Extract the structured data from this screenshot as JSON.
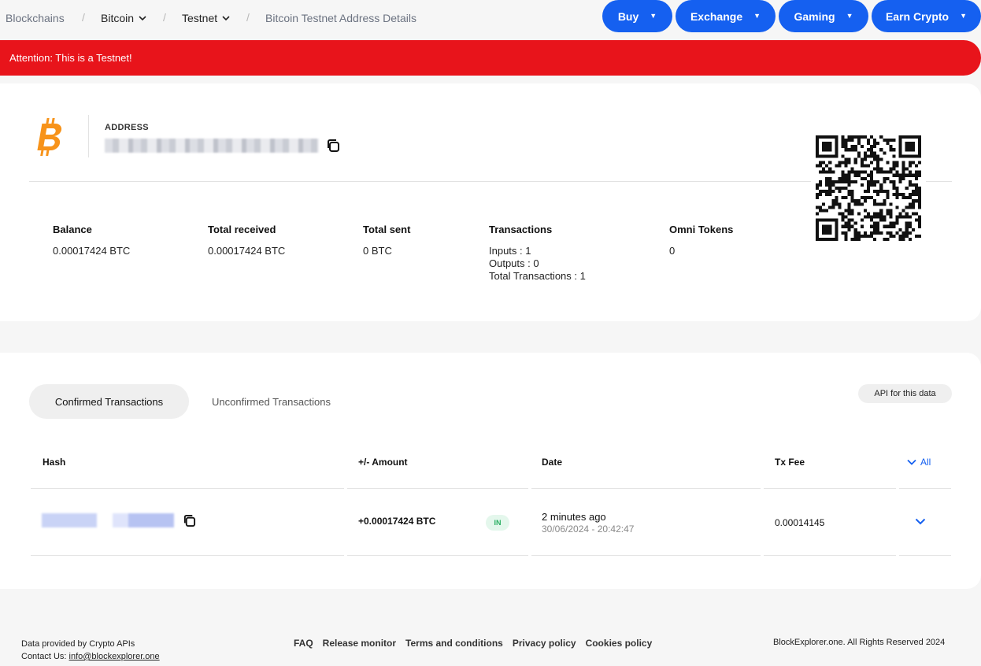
{
  "breadcrumb": {
    "root": "Blockchains",
    "chain": "Bitcoin",
    "network": "Testnet",
    "current": "Bitcoin Testnet Address Details"
  },
  "nav": {
    "buy": "Buy",
    "exchange": "Exchange",
    "gaming": "Gaming",
    "earn": "Earn Crypto"
  },
  "banner": "Attention: This is a Testnet!",
  "address": {
    "label": "ADDRESS"
  },
  "stats": {
    "balance_label": "Balance",
    "balance_value": "0.00017424 BTC",
    "received_label": "Total received",
    "received_value": "0.00017424 BTC",
    "sent_label": "Total sent",
    "sent_value": "0 BTC",
    "tx_label": "Transactions",
    "tx_inputs": "Inputs : 1",
    "tx_outputs": "Outputs : 0",
    "tx_total": "Total Transactions : 1",
    "omni_label": "Omni Tokens",
    "omni_value": "0"
  },
  "tabs": {
    "confirmed": "Confirmed Transactions",
    "unconfirmed": "Unconfirmed Transactions",
    "api": "API for this data"
  },
  "table": {
    "headers": {
      "hash": "Hash",
      "amount": "+/- Amount",
      "date": "Date",
      "fee": "Tx Fee",
      "all": "All"
    },
    "rows": [
      {
        "amount": "+0.00017424 BTC",
        "direction": "IN",
        "relative": "2 minutes ago",
        "datetime": "30/06/2024 - 20:42:47",
        "fee": "0.00014145"
      }
    ]
  },
  "footer": {
    "provided": "Data provided by Crypto APIs",
    "contact_label": "Contact Us:",
    "contact_email": "info@blockexplorer.one",
    "links": [
      "FAQ",
      "Release monitor",
      "Terms and conditions",
      "Privacy policy",
      "Cookies policy"
    ],
    "copyright": "BlockExplorer.one. All Rights Reserved 2024"
  },
  "colors": {
    "accent": "#1560f0",
    "banner": "#e8141b",
    "bitcoin": "#f7931a",
    "in_badge": "#27ae60"
  }
}
